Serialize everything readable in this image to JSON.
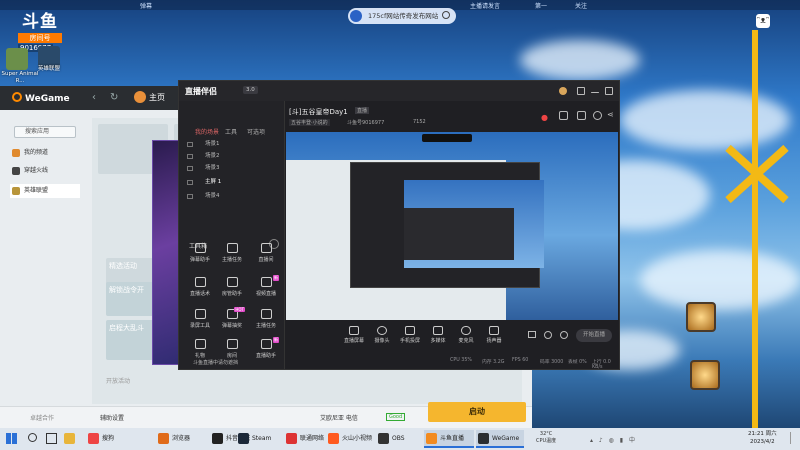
{
  "topbar": {
    "left": "弹幕",
    "center": "主播请发言",
    "right1": "第一",
    "right2": "关注"
  },
  "douyu": {
    "logo": "斗鱼",
    "room_label": "房间号",
    "room_no": "9016977"
  },
  "desktop": {
    "icon1": "Super Animal R...",
    "icon2": "英雄联盟"
  },
  "top_search": {
    "text": "175cf网站传奇发布网站"
  },
  "wegame": {
    "logo": "WeGame",
    "home": "主页",
    "search": "搜索应用",
    "items": [
      "我的频道",
      "穿越火线",
      "英雄联盟"
    ],
    "bottom_left": "卓越合作",
    "helper": "辅助设置",
    "region": "艾欧尼亚 电信",
    "region_badge": "Good",
    "start": "启动",
    "blocks": [
      "精选活动",
      "新赛季",
      "新版本"
    ],
    "mid1": "解锁战令开",
    "mid2": "启程大乱斗",
    "panel_title": "开放活动"
  },
  "zbs": {
    "logo": "直播伴侣",
    "version": "3.0",
    "tabs": [
      "我的场景",
      "工具",
      "可选项"
    ],
    "scenes": [
      "场景1",
      "场景2",
      "场景3",
      "主屏 1",
      "场景4"
    ],
    "tools_title": "工具箱",
    "tools": [
      "弹幕助手",
      "主播任务",
      "直播间",
      "直播话术",
      "房管助手",
      "视频直播",
      "录屏工具",
      "弹幕抽奖",
      "主播任务",
      "礼物",
      "房间",
      "直播助手"
    ],
    "tool_badges": [
      "",
      "",
      "新",
      "",
      "",
      "新",
      "",
      "HOT",
      "",
      "",
      "",
      "新"
    ],
    "stream_title": "[斗]五谷皇帝Day1",
    "title_tag": "直播",
    "sub1": "五谷丰登·小说的",
    "sub2": "斗鱼号9016977",
    "sub3": "7152",
    "bottom_tip": "斗鱼直播中请勿遮挡",
    "controls": [
      "直播屏幕",
      "摄像头",
      "手机投屏",
      "多媒体",
      "麦克风",
      "扬声器"
    ],
    "start_btn": "开始直播",
    "status": [
      "CPU 35%",
      "内存 3.2G",
      "FPS 60",
      "码率 3000",
      "丢帧 0%",
      "上行 0.0 KB/s"
    ]
  },
  "taskbar": {
    "items": [
      "搜狗",
      "浏览器",
      "抖音商城",
      "Steam",
      "联通网络",
      "火山小视频",
      "OBS",
      "斗鱼直播",
      "WeGame"
    ],
    "tray1": "CPU温度",
    "tray2": "32°C",
    "time": "21:21 周六",
    "date": "2023/4/2"
  }
}
